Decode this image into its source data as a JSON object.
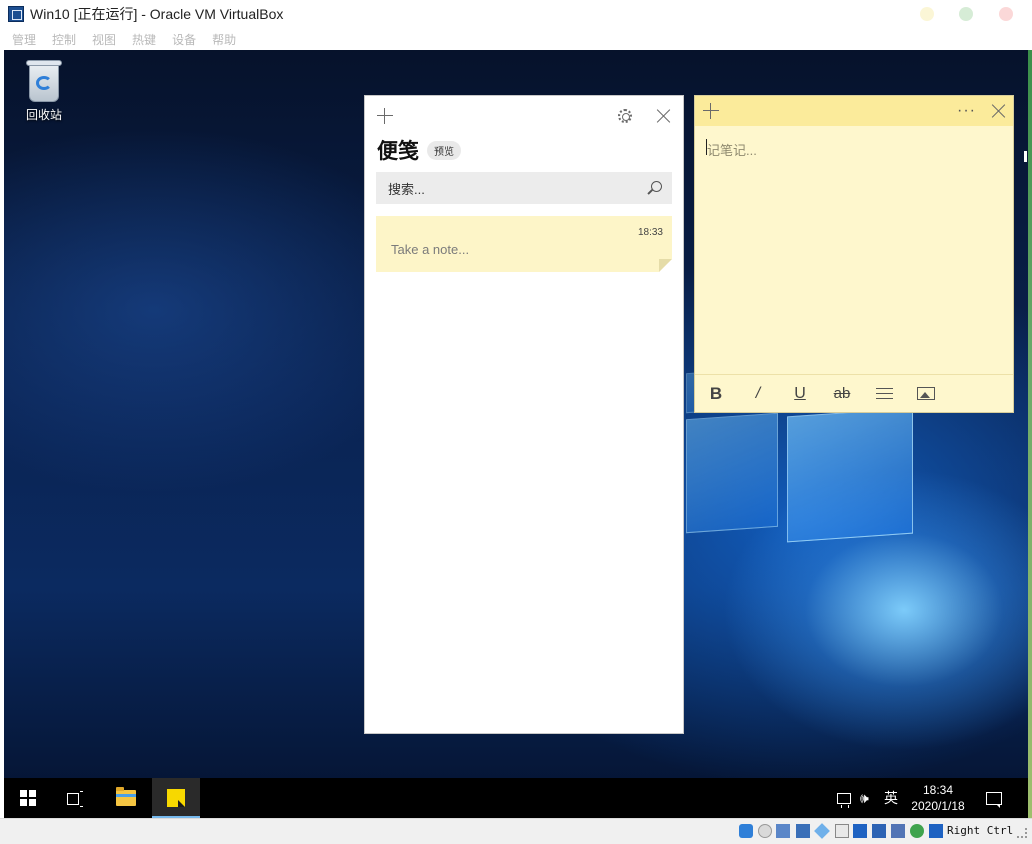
{
  "host": {
    "title": "Win10 [正在运行] - Oracle VM VirtualBox",
    "menu": [
      "管理",
      "控制",
      "视图",
      "热键",
      "设备",
      "帮助"
    ],
    "host_key": "Right Ctrl"
  },
  "desktop": {
    "recycle_bin_label": "回收站"
  },
  "sticky_list": {
    "title": "便笺",
    "badge": "预览",
    "search_placeholder": "搜索...",
    "notes": [
      {
        "time": "18:33",
        "preview": "Take a note..."
      }
    ]
  },
  "sticky_editor": {
    "more_label": "···",
    "placeholder": "记笔记...",
    "toolbar": {
      "bold": "B",
      "italic": "/",
      "underline": "U",
      "strike": "ab"
    }
  },
  "taskbar": {
    "ime": "英",
    "time": "18:34",
    "date": "2020/1/18",
    "volume_icon": "🕪"
  },
  "colors": {
    "note_yellow": "#fef7cd",
    "note_header": "#fbeb9b",
    "card_yellow": "#fdf5c8",
    "taskbar": "#000000",
    "accent": "#76b9ed"
  },
  "icons": [
    "virtualbox-icon",
    "recycle-bin-icon",
    "add-icon",
    "settings-icon",
    "close-icon",
    "search-icon",
    "more-icon",
    "list-icon",
    "image-icon",
    "windows-start-icon",
    "task-view-icon",
    "file-explorer-icon",
    "sticky-notes-icon",
    "network-icon",
    "volume-icon",
    "notification-icon"
  ]
}
